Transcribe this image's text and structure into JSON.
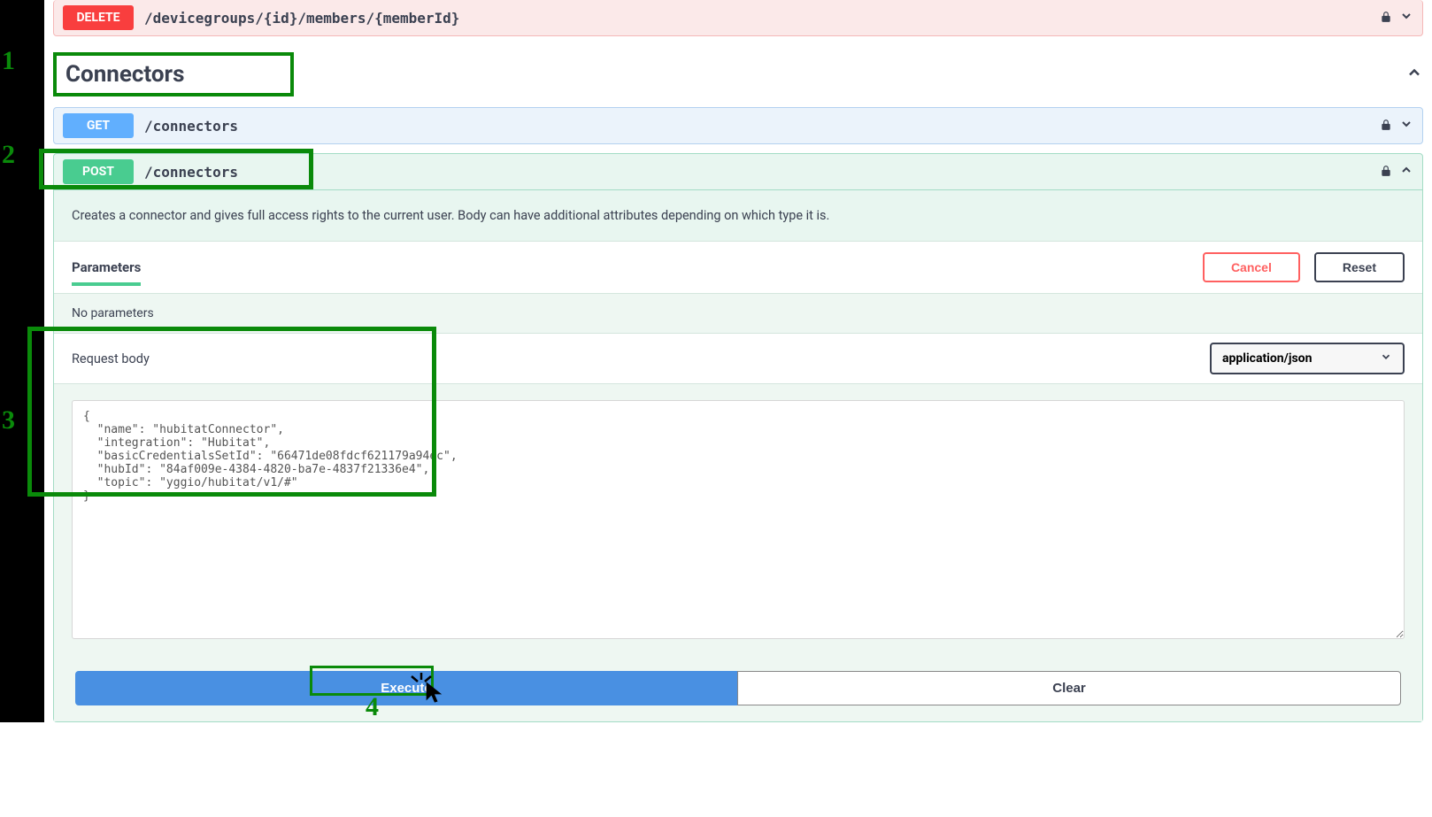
{
  "delete_op": {
    "method": "DELETE",
    "path": "/devicegroups/{id}/members/{memberId}"
  },
  "section": {
    "title": "Connectors"
  },
  "get_op": {
    "method": "GET",
    "path": "/connectors"
  },
  "post_op": {
    "method": "POST",
    "path": "/connectors",
    "description": "Creates a connector and gives full access rights to the current user. Body can have additional attributes depending on which type it is."
  },
  "params": {
    "tab_label": "Parameters",
    "cancel_label": "Cancel",
    "reset_label": "Reset",
    "empty_text": "No parameters"
  },
  "request_body": {
    "label": "Request body",
    "content_type": "application/json",
    "body_text": "{\n  \"name\": \"hubitatConnector\",\n  \"integration\": \"Hubitat\",\n  \"basicCredentialsSetId\": \"66471de08fdcf621179a94ec\",\n  \"hubId\": \"84af009e-4384-4820-ba7e-4837f21336e4\",\n  \"topic\": \"yggio/hubitat/v1/#\"\n}"
  },
  "actions": {
    "execute": "Execute",
    "clear": "Clear"
  },
  "annotations": {
    "n1": "1",
    "n2": "2",
    "n3": "3",
    "n4": "4"
  }
}
